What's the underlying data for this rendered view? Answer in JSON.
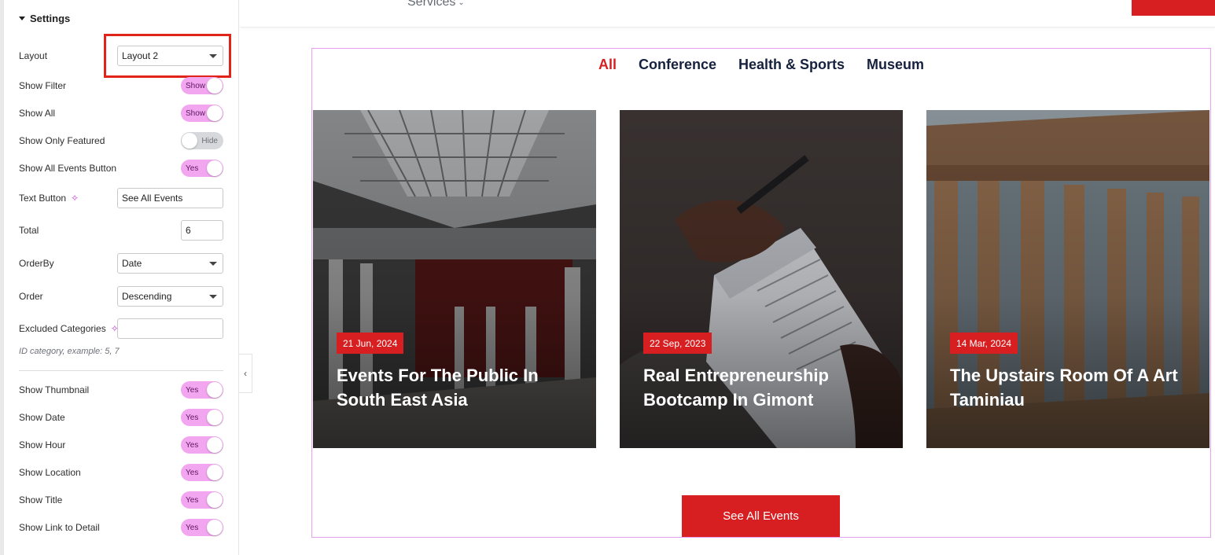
{
  "settings": {
    "section_title": "Settings",
    "layout": {
      "label": "Layout",
      "value": "Layout 2"
    },
    "show_filter": {
      "label": "Show Filter",
      "state": "Show"
    },
    "show_all": {
      "label": "Show All",
      "state": "Show"
    },
    "show_only_featured": {
      "label": "Show Only Featured",
      "state": "Hide"
    },
    "show_all_events_button": {
      "label": "Show All Events Button",
      "state": "Yes"
    },
    "text_button": {
      "label": "Text Button",
      "value": "See All Events"
    },
    "total": {
      "label": "Total",
      "value": "6"
    },
    "orderby": {
      "label": "OrderBy",
      "value": "Date"
    },
    "order": {
      "label": "Order",
      "value": "Descending"
    },
    "excluded_categories": {
      "label": "Excluded Categories",
      "value": "",
      "hint": "ID category, example: 5, 7"
    },
    "show_thumbnail": {
      "label": "Show Thumbnail",
      "state": "Yes"
    },
    "show_date": {
      "label": "Show Date",
      "state": "Yes"
    },
    "show_hour": {
      "label": "Show Hour",
      "state": "Yes"
    },
    "show_location": {
      "label": "Show Location",
      "state": "Yes"
    },
    "show_title": {
      "label": "Show Title",
      "state": "Yes"
    },
    "show_link_to_detail": {
      "label": "Show Link to Detail",
      "state": "Yes"
    }
  },
  "nav": {
    "services": "Services"
  },
  "filters": [
    "All",
    "Conference",
    "Health & Sports",
    "Museum"
  ],
  "events": [
    {
      "date": "21 Jun, 2024",
      "title": "Events For The Public In South East Asia"
    },
    {
      "date": "22 Sep, 2023",
      "title": "Real Entrepreneurship Bootcamp In Gimont"
    },
    {
      "date": "14 Mar, 2024",
      "title": "The Upstairs Room Of A Art Taminiau"
    }
  ],
  "see_all_button": "See All Events",
  "colors": {
    "accent_red": "#d71f22",
    "toggle_on": "#f2a6f0",
    "highlight_red": "#e0241a",
    "navy": "#16213e",
    "widget_border": "#e89ff0"
  },
  "icons": {
    "sparkle": "sparkle-icon",
    "collapse": "chevron-left-icon",
    "caret": "caret-down-icon"
  }
}
